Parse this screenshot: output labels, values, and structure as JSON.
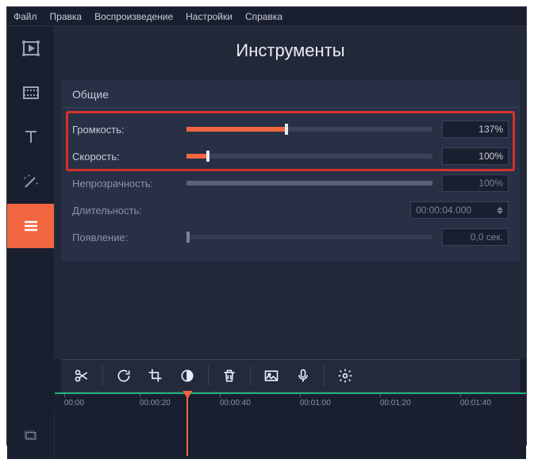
{
  "menu": {
    "file": "Файл",
    "edit": "Правка",
    "play": "Воспроизведение",
    "settings": "Настройки",
    "help": "Справка"
  },
  "title": "Инструменты",
  "panel": {
    "heading": "Общие"
  },
  "rows": {
    "volume": {
      "label": "Громкость:",
      "value": "137%",
      "fill": 40
    },
    "speed": {
      "label": "Скорость:",
      "value": "100%",
      "fill": 8
    },
    "opacity": {
      "label": "Непрозрачность:",
      "value": "100%",
      "fill": 100
    },
    "duration": {
      "label": "Длительность:",
      "value": "00:00:04.000"
    },
    "appear": {
      "label": "Появление:",
      "value": "0,0 сек.",
      "fill": 0
    }
  },
  "timeline": {
    "ticks": [
      "00:00",
      "00:00:20",
      "00:00:40",
      "00:01:00",
      "00:01:20",
      "00:01:40"
    ],
    "playhead_pct": 28
  }
}
